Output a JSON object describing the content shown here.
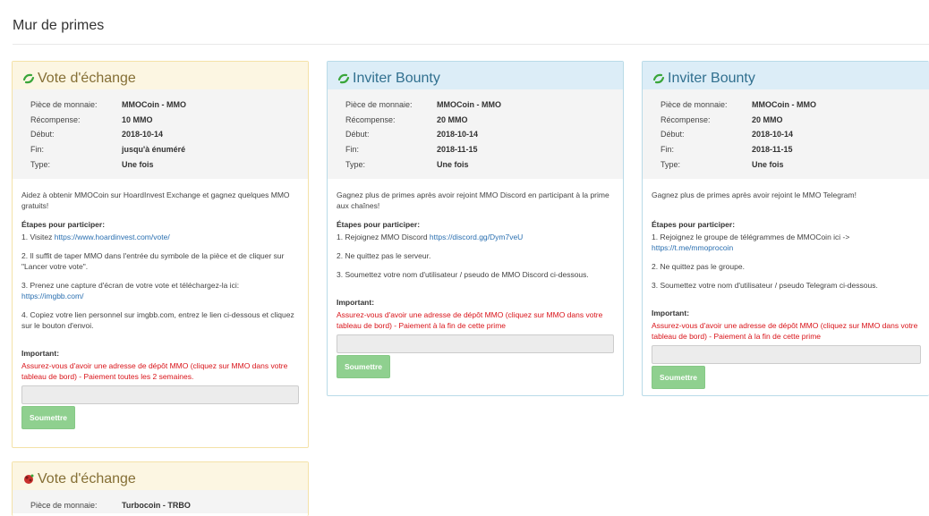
{
  "page": {
    "title": "Mur de primes"
  },
  "cards": [
    {
      "title": "Vote d'échange",
      "details": [
        {
          "label": "Pièce de monnaie:",
          "value": "MMOCoin - MMO"
        },
        {
          "label": "Récompense:",
          "value": "10 MMO"
        },
        {
          "label": "Début:",
          "value": "2018-10-14"
        },
        {
          "label": "Fin:",
          "value": "jusqu'à énuméré"
        },
        {
          "label": "Type:",
          "value": "Une fois"
        }
      ],
      "intro": "Aidez à obtenir MMOCoin sur HoardInvest Exchange et gagnez quelques MMO gratuits!",
      "steps_heading": "Étapes pour participer:",
      "steps": [
        {
          "text": "1. Visitez ",
          "link": "https://www.hoardinvest.com/vote/"
        },
        {
          "text": "2. Il suffit de taper MMO dans l'entrée du symbole de la pièce et de cliquer sur \"Lancer votre vote\"."
        },
        {
          "text": "3. Prenez une capture d'écran de votre vote et téléchargez-la ici: ",
          "link": "https://imgbb.com/"
        },
        {
          "text": "4. Copiez votre lien personnel sur imgbb.com, entrez le lien ci-dessous et cliquez sur le bouton d'envoi."
        }
      ],
      "important_heading": "Important:",
      "warning": "Assurez-vous d'avoir une adresse de dépôt MMO (cliquez sur MMO dans votre tableau de bord) - Paiement toutes les 2 semaines.",
      "input_value": "",
      "submit_label": "Soumettre"
    },
    {
      "title": "Inviter Bounty",
      "details": [
        {
          "label": "Pièce de monnaie:",
          "value": "MMOCoin - MMO"
        },
        {
          "label": "Récompense:",
          "value": "20 MMO"
        },
        {
          "label": "Début:",
          "value": "2018-10-14"
        },
        {
          "label": "Fin:",
          "value": "2018-11-15"
        },
        {
          "label": "Type:",
          "value": "Une fois"
        }
      ],
      "intro": "Gagnez plus de primes après avoir rejoint MMO Discord en participant à la prime aux chaînes!",
      "steps_heading": "Étapes pour participer:",
      "steps": [
        {
          "text": "1. Rejoignez MMO Discord ",
          "link": "https://discord.gg/Dym7veU"
        },
        {
          "text": "2. Ne quittez pas le serveur."
        },
        {
          "text": "3. Soumettez votre nom d'utilisateur / pseudo de MMO Discord ci-dessous."
        }
      ],
      "important_heading": "Important:",
      "warning": "Assurez-vous d'avoir une adresse de dépôt MMO (cliquez sur MMO dans votre tableau de bord) - Paiement à la fin de cette prime",
      "input_value": "",
      "submit_label": "Soumettre"
    },
    {
      "title": "Inviter Bounty",
      "details": [
        {
          "label": "Pièce de monnaie:",
          "value": "MMOCoin - MMO"
        },
        {
          "label": "Récompense:",
          "value": "20 MMO"
        },
        {
          "label": "Début:",
          "value": "2018-10-14"
        },
        {
          "label": "Fin:",
          "value": "2018-11-15"
        },
        {
          "label": "Type:",
          "value": "Une fois"
        }
      ],
      "intro": "Gagnez plus de primes après avoir rejoint le MMO Telegram!",
      "steps_heading": "Étapes pour participer:",
      "steps": [
        {
          "text": "1. Rejoignez le groupe de télégrammes de MMOCoin ici -> ",
          "link": "https://t.me/mmoprocoin"
        },
        {
          "text": "2. Ne quittez pas le groupe."
        },
        {
          "text": "3. Soumettez votre nom d'utilisateur / pseudo Telegram ci-dessous."
        }
      ],
      "important_heading": "Important:",
      "warning": "Assurez-vous d'avoir une adresse de dépôt MMO (cliquez sur MMO dans votre tableau de bord) - Paiement à la fin de cette prime",
      "input_value": "",
      "submit_label": "Soumettre"
    },
    {
      "title": "Vote d'échange",
      "details": [
        {
          "label": "Pièce de monnaie:",
          "value": "Turbocoin - TRBO"
        }
      ]
    }
  ],
  "colors": {
    "yellow_head": "#fcf6e2",
    "blue_head": "#dcedf7",
    "warning": "#d9141a",
    "submit": "#8fd08f",
    "link": "#2a6fb0"
  }
}
